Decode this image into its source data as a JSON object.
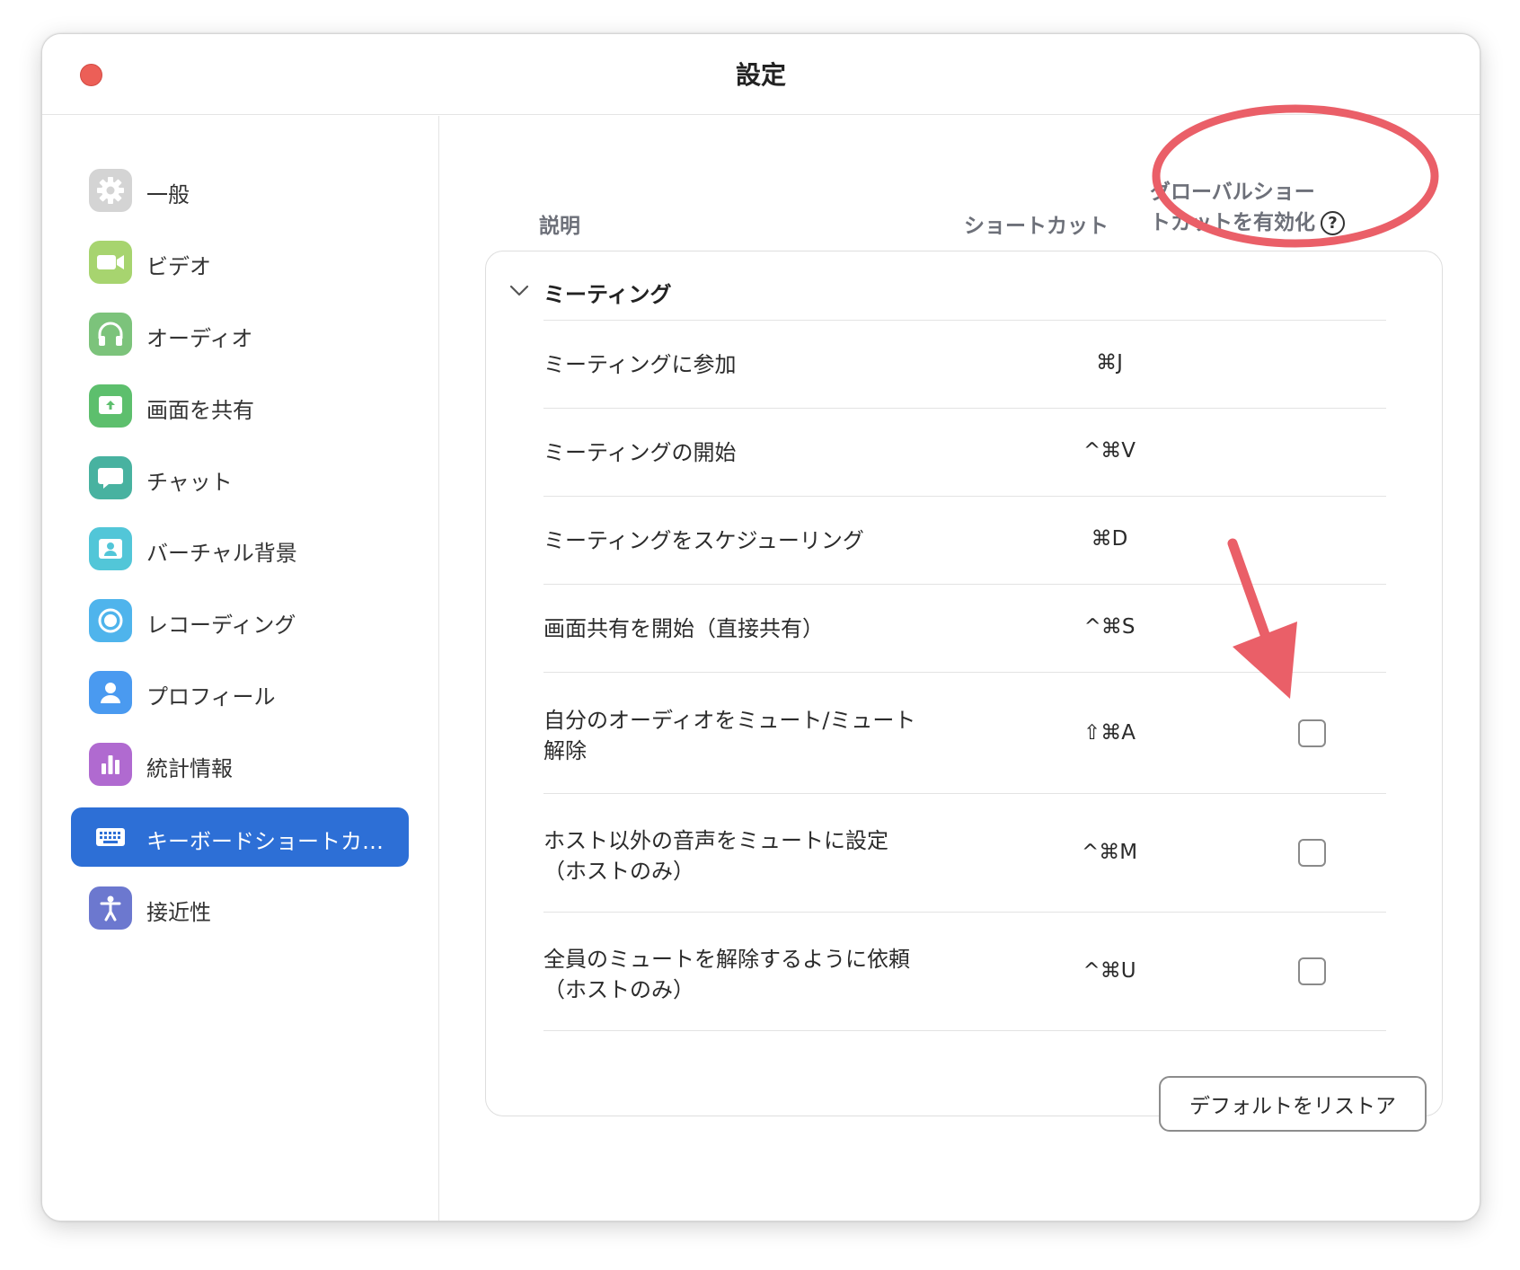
{
  "window": {
    "title": "設定"
  },
  "sidebar": {
    "items": [
      {
        "label": "一般",
        "icon": "gear-icon",
        "color": "#c9c9c9",
        "active": false
      },
      {
        "label": "ビデオ",
        "icon": "video-camera-icon",
        "color": "#9fd06f",
        "active": false
      },
      {
        "label": "オーディオ",
        "icon": "headphones-icon",
        "color": "#7cc37b",
        "active": false
      },
      {
        "label": "画面を共有",
        "icon": "share-screen-icon",
        "color": "#5dbf6d",
        "active": false
      },
      {
        "label": "チャット",
        "icon": "chat-bubble-icon",
        "color": "#48b2a0",
        "active": false
      },
      {
        "label": "バーチャル背景",
        "icon": "virtual-background-icon",
        "color": "#52c6d8",
        "active": false
      },
      {
        "label": "レコーディング",
        "icon": "record-icon",
        "color": "#4fb4ec",
        "active": false
      },
      {
        "label": "プロフィール",
        "icon": "profile-icon",
        "color": "#4a9af0",
        "active": false
      },
      {
        "label": "統計情報",
        "icon": "statistics-icon",
        "color": "#b06ad0",
        "active": false
      },
      {
        "label": "キーボードショートカ…",
        "icon": "keyboard-icon",
        "color": "#2d6fd6",
        "active": true
      },
      {
        "label": "接近性",
        "icon": "accessibility-icon",
        "color": "#6c78cf",
        "active": false
      }
    ]
  },
  "headers": {
    "description": "説明",
    "shortcut": "ショートカット",
    "global_line1": "グローバルショー",
    "global_line2": "トカットを有効化",
    "help_glyph": "?"
  },
  "section": {
    "title": "ミーティング",
    "expanded": true
  },
  "rows": [
    {
      "line1": "ミーティングに参加",
      "line2": "",
      "key": "⌘J",
      "has_checkbox": false,
      "checked": false
    },
    {
      "line1": "ミーティングの開始",
      "line2": "",
      "key": "^⌘V",
      "has_checkbox": false,
      "checked": false
    },
    {
      "line1": "ミーティングをスケジューリング",
      "line2": "",
      "key": "⌘D",
      "has_checkbox": false,
      "checked": false
    },
    {
      "line1": "画面共有を開始（直接共有）",
      "line2": "",
      "key": "^⌘S",
      "has_checkbox": false,
      "checked": false
    },
    {
      "line1": "自分のオーディオをミュート/ミュート",
      "line2": "解除",
      "key": "⇧⌘A",
      "has_checkbox": true,
      "checked": false
    },
    {
      "line1": "ホスト以外の音声をミュートに設定",
      "line2": "（ホストのみ）",
      "key": "^⌘M",
      "has_checkbox": true,
      "checked": false
    },
    {
      "line1": "全員のミュートを解除するように依頼",
      "line2": "（ホストのみ）",
      "key": "^⌘U",
      "has_checkbox": true,
      "checked": false
    }
  ],
  "footer": {
    "restore_label": "デフォルトをリストア"
  },
  "annotations": {
    "color": "#ea5f68"
  }
}
